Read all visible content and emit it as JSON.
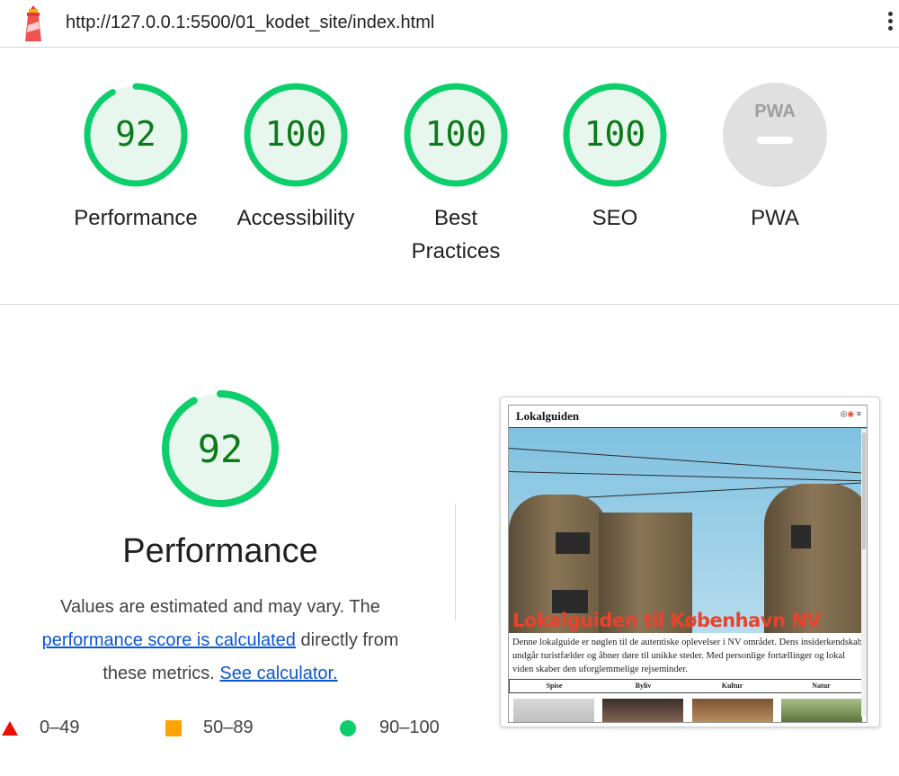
{
  "header": {
    "url": "http://127.0.0.1:5500/01_kodet_site/index.html"
  },
  "gauges": [
    {
      "label": "Performance",
      "score": "92",
      "value": 0.92
    },
    {
      "label": "Accessibility",
      "score": "100",
      "value": 1.0
    },
    {
      "label": "Best Practices",
      "label_line1": "Best",
      "label_line2": "Practices",
      "score": "100",
      "value": 1.0
    },
    {
      "label": "SEO",
      "score": "100",
      "value": 1.0
    },
    {
      "label": "PWA",
      "badge": "PWA"
    }
  ],
  "performance": {
    "score": "92",
    "value": 0.92,
    "title": "Performance",
    "desc_1": "Values are estimated and may vary. The",
    "link_1": "performance score is calculated",
    "desc_2": "directly from",
    "desc_3": "these metrics.",
    "link_2": "See calculator."
  },
  "legend": [
    {
      "range": "0–49",
      "color": "#eb0f00"
    },
    {
      "range": "50–89",
      "color": "#ffa400"
    },
    {
      "range": "90–100",
      "color": "#0cce6b"
    }
  ],
  "colors": {
    "pass": "#0cce6b",
    "pass_fill": "#e8f7ee",
    "pass_text": "#0c7a1b",
    "pwa_gray": "#e0e0e0",
    "link": "#0b57d0"
  },
  "site_preview": {
    "site_name": "Lokalguiden",
    "hero_title": "Lokalguiden til København NV",
    "intro": "Denne lokalguide er nøglen til de autentiske oplevelser i NV området. Dens insiderkendskab undgår turistfælder og åbner døre til unikke steder. Med personlige fortællinger og lokal viden skaber den uforglemmelige rejseminder.",
    "nav": [
      "Spise",
      "Byliv",
      "Kultur",
      "Natur"
    ]
  }
}
